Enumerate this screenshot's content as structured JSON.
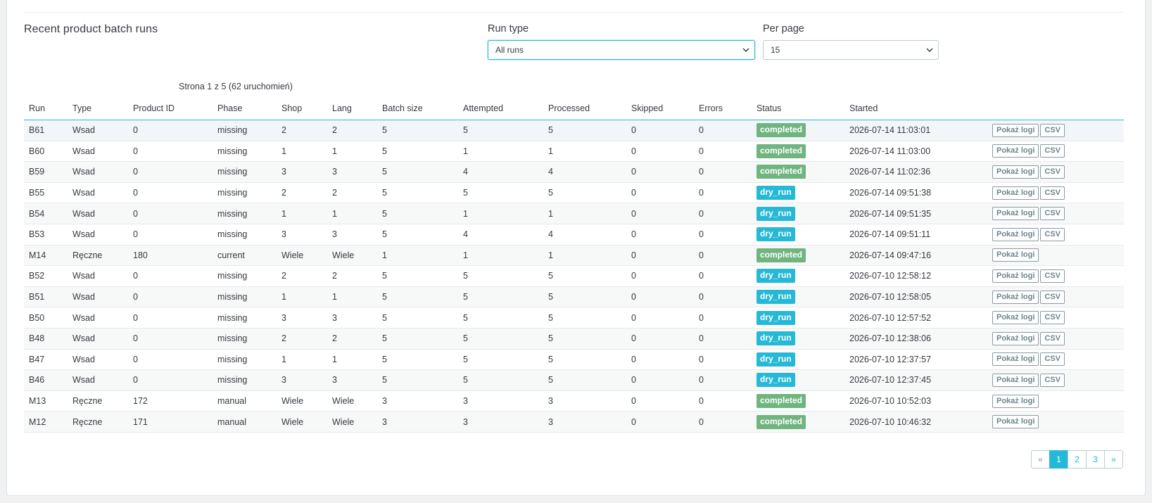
{
  "section": {
    "title": "Recent product batch runs"
  },
  "filters": {
    "run_type_label": "Run type",
    "run_type_value": "All runs",
    "per_page_label": "Per page",
    "per_page_value": "15"
  },
  "pagination_info": "Strona 1 z 5 (62 uruchomień)",
  "table": {
    "columns": [
      "Run",
      "Type",
      "Product ID",
      "Phase",
      "Shop",
      "Lang",
      "Batch size",
      "Attempted",
      "Processed",
      "Skipped",
      "Errors",
      "Status",
      "Started"
    ],
    "show_logs_label": "Pokaż logi",
    "csv_label": "CSV",
    "rows": [
      {
        "run": "B61",
        "type": "Wsad",
        "product_id": "0",
        "phase": "missing",
        "shop": "2",
        "lang": "2",
        "batch_size": "5",
        "attempted": "5",
        "processed": "5",
        "skipped": "0",
        "errors": "0",
        "status": "completed",
        "started": "2026-07-14 11:03:01",
        "csv": true
      },
      {
        "run": "B60",
        "type": "Wsad",
        "product_id": "0",
        "phase": "missing",
        "shop": "1",
        "lang": "1",
        "batch_size": "5",
        "attempted": "1",
        "processed": "1",
        "skipped": "0",
        "errors": "0",
        "status": "completed",
        "started": "2026-07-14 11:03:00",
        "csv": true
      },
      {
        "run": "B59",
        "type": "Wsad",
        "product_id": "0",
        "phase": "missing",
        "shop": "3",
        "lang": "3",
        "batch_size": "5",
        "attempted": "4",
        "processed": "4",
        "skipped": "0",
        "errors": "0",
        "status": "completed",
        "started": "2026-07-14 11:02:36",
        "csv": true
      },
      {
        "run": "B55",
        "type": "Wsad",
        "product_id": "0",
        "phase": "missing",
        "shop": "2",
        "lang": "2",
        "batch_size": "5",
        "attempted": "5",
        "processed": "5",
        "skipped": "0",
        "errors": "0",
        "status": "dry_run",
        "started": "2026-07-14 09:51:38",
        "csv": true
      },
      {
        "run": "B54",
        "type": "Wsad",
        "product_id": "0",
        "phase": "missing",
        "shop": "1",
        "lang": "1",
        "batch_size": "5",
        "attempted": "1",
        "processed": "1",
        "skipped": "0",
        "errors": "0",
        "status": "dry_run",
        "started": "2026-07-14 09:51:35",
        "csv": true
      },
      {
        "run": "B53",
        "type": "Wsad",
        "product_id": "0",
        "phase": "missing",
        "shop": "3",
        "lang": "3",
        "batch_size": "5",
        "attempted": "4",
        "processed": "4",
        "skipped": "0",
        "errors": "0",
        "status": "dry_run",
        "started": "2026-07-14 09:51:11",
        "csv": true
      },
      {
        "run": "M14",
        "type": "Ręczne",
        "product_id": "180",
        "phase": "current",
        "shop": "Wiele",
        "lang": "Wiele",
        "batch_size": "1",
        "attempted": "1",
        "processed": "1",
        "skipped": "0",
        "errors": "0",
        "status": "completed",
        "started": "2026-07-14 09:47:16",
        "csv": false
      },
      {
        "run": "B52",
        "type": "Wsad",
        "product_id": "0",
        "phase": "missing",
        "shop": "2",
        "lang": "2",
        "batch_size": "5",
        "attempted": "5",
        "processed": "5",
        "skipped": "0",
        "errors": "0",
        "status": "dry_run",
        "started": "2026-07-10 12:58:12",
        "csv": true
      },
      {
        "run": "B51",
        "type": "Wsad",
        "product_id": "0",
        "phase": "missing",
        "shop": "1",
        "lang": "1",
        "batch_size": "5",
        "attempted": "5",
        "processed": "5",
        "skipped": "0",
        "errors": "0",
        "status": "dry_run",
        "started": "2026-07-10 12:58:05",
        "csv": true
      },
      {
        "run": "B50",
        "type": "Wsad",
        "product_id": "0",
        "phase": "missing",
        "shop": "3",
        "lang": "3",
        "batch_size": "5",
        "attempted": "5",
        "processed": "5",
        "skipped": "0",
        "errors": "0",
        "status": "dry_run",
        "started": "2026-07-10 12:57:52",
        "csv": true
      },
      {
        "run": "B48",
        "type": "Wsad",
        "product_id": "0",
        "phase": "missing",
        "shop": "2",
        "lang": "2",
        "batch_size": "5",
        "attempted": "5",
        "processed": "5",
        "skipped": "0",
        "errors": "0",
        "status": "dry_run",
        "started": "2026-07-10 12:38:06",
        "csv": true
      },
      {
        "run": "B47",
        "type": "Wsad",
        "product_id": "0",
        "phase": "missing",
        "shop": "1",
        "lang": "1",
        "batch_size": "5",
        "attempted": "5",
        "processed": "5",
        "skipped": "0",
        "errors": "0",
        "status": "dry_run",
        "started": "2026-07-10 12:37:57",
        "csv": true
      },
      {
        "run": "B46",
        "type": "Wsad",
        "product_id": "0",
        "phase": "missing",
        "shop": "3",
        "lang": "3",
        "batch_size": "5",
        "attempted": "5",
        "processed": "5",
        "skipped": "0",
        "errors": "0",
        "status": "dry_run",
        "started": "2026-07-10 12:37:45",
        "csv": true
      },
      {
        "run": "M13",
        "type": "Ręczne",
        "product_id": "172",
        "phase": "manual",
        "shop": "Wiele",
        "lang": "Wiele",
        "batch_size": "3",
        "attempted": "3",
        "processed": "3",
        "skipped": "0",
        "errors": "0",
        "status": "completed",
        "started": "2026-07-10 10:52:03",
        "csv": false
      },
      {
        "run": "M12",
        "type": "Ręczne",
        "product_id": "171",
        "phase": "manual",
        "shop": "Wiele",
        "lang": "Wiele",
        "batch_size": "3",
        "attempted": "3",
        "processed": "3",
        "skipped": "0",
        "errors": "0",
        "status": "completed",
        "started": "2026-07-10 10:46:32",
        "csv": false
      }
    ]
  },
  "pager": {
    "prev": "«",
    "pages": [
      "1",
      "2",
      "3"
    ],
    "active": "1",
    "next": "»"
  },
  "colors": {
    "accent": "#25b9d7",
    "completed": "#70b580",
    "dry_run": "#25b9d7"
  }
}
